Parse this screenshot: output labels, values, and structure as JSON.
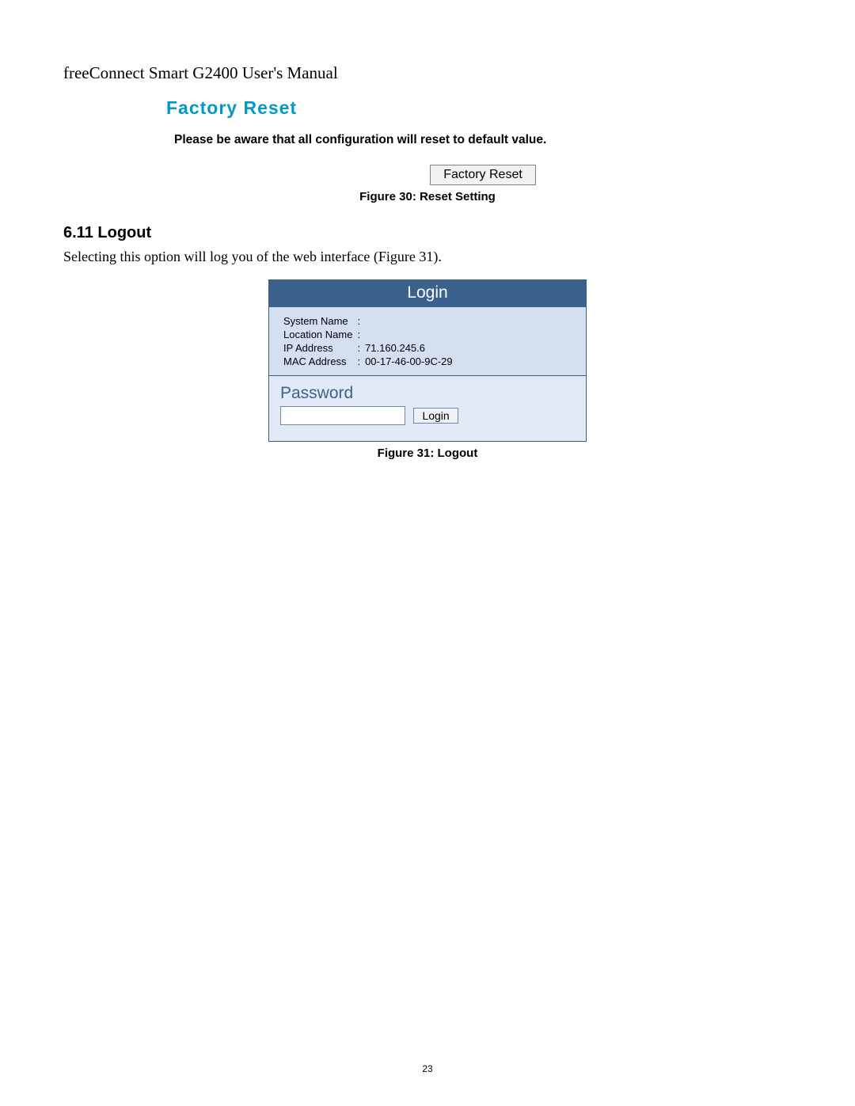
{
  "doc_header": "freeConnect Smart G2400 User's Manual",
  "factory": {
    "title": "Factory Reset",
    "warning": "Please be aware that all configuration will reset to default value.",
    "button_label": "Factory Reset",
    "figure_caption": "Figure 30: Reset Setting"
  },
  "section": {
    "heading": "6.11  Logout",
    "body": "Selecting this option will log you of the web interface (Figure 31)."
  },
  "login": {
    "header": "Login",
    "info": {
      "system_name_label": "System Name",
      "system_name_value": "",
      "location_name_label": "Location Name",
      "location_name_value": "",
      "ip_address_label": "IP Address",
      "ip_address_value": "71.160.245.6",
      "mac_address_label": "MAC Address",
      "mac_address_value": "00-17-46-00-9C-29"
    },
    "password_label": "Password",
    "password_value": "",
    "login_button_label": "Login",
    "figure_caption": "Figure 31: Logout"
  },
  "page_number": "23"
}
